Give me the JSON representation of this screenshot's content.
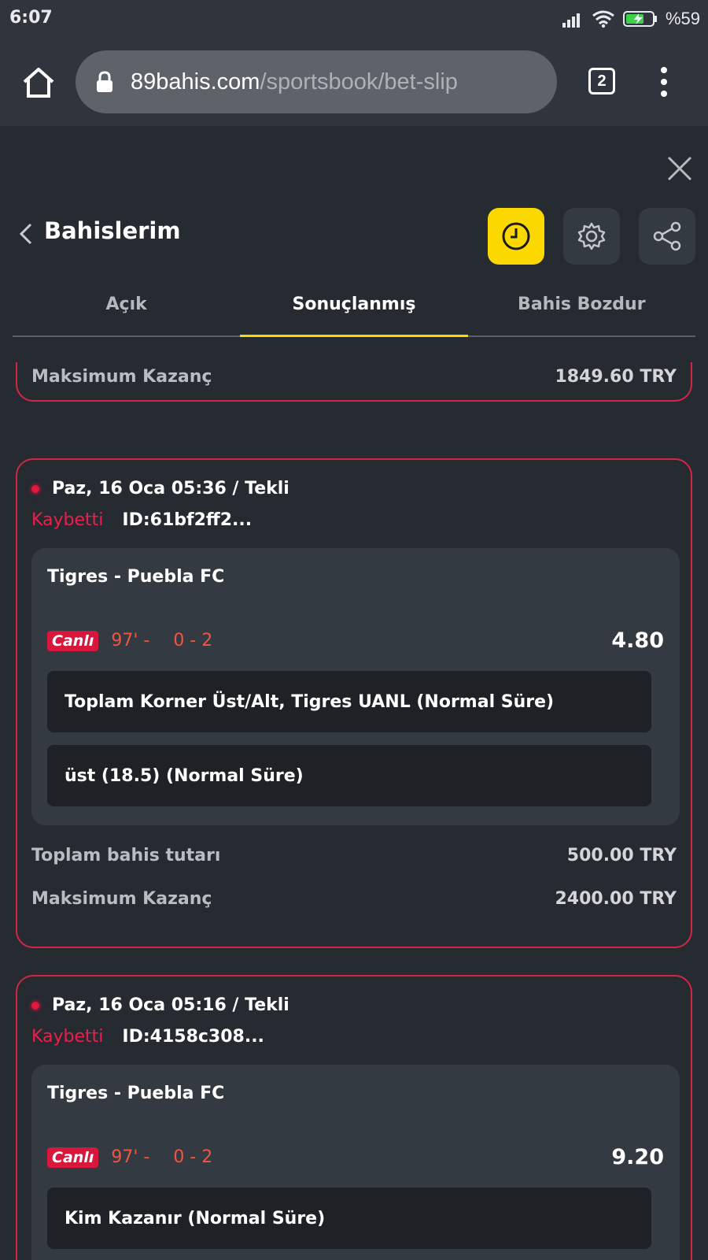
{
  "status_bar": {
    "time": "6:07",
    "battery": "%59"
  },
  "browser": {
    "url_host": "89bahis.com",
    "url_path": "/sportsbook/bet-slip",
    "tab_count": "2"
  },
  "header": {
    "title": "Bahislerim"
  },
  "tabs": [
    {
      "label": "Açık",
      "active": false
    },
    {
      "label": "Sonuçlanmış",
      "active": true
    },
    {
      "label": "Bahis Bozdur",
      "active": false
    }
  ],
  "partial_card": {
    "max_win_label": "Maksimum Kazanç",
    "max_win_value": "1849.60 TRY"
  },
  "bets": [
    {
      "datetime": "Paz, 16 Oca 05:36 / Tekli",
      "result": "Kaybetti",
      "id": "ID:61bf2ff2...",
      "match": "Tigres - Puebla FC",
      "live_label": "Canlı",
      "minute": "97' -",
      "score": "0 - 2",
      "odds": "4.80",
      "selections": [
        "Toplam Korner Üst/Alt, Tigres UANL (Normal Süre)",
        "üst (18.5) (Normal Süre)"
      ],
      "stake_label": "Toplam bahis tutarı",
      "stake_value": "500.00 TRY",
      "max_win_label": "Maksimum Kazanç",
      "max_win_value": "2400.00 TRY"
    },
    {
      "datetime": "Paz, 16 Oca 05:16 / Tekli",
      "result": "Kaybetti",
      "id": "ID:4158c308...",
      "match": "Tigres - Puebla FC",
      "live_label": "Canlı",
      "minute": "97' -",
      "score": "0 - 2",
      "odds": "9.20",
      "selections": [
        "Kim Kazanır (Normal Süre)"
      ]
    }
  ],
  "colors": {
    "accent": "#fbd900",
    "loss": "#ec1f4b",
    "card_border": "#d1254a",
    "live": "#d8173d"
  }
}
